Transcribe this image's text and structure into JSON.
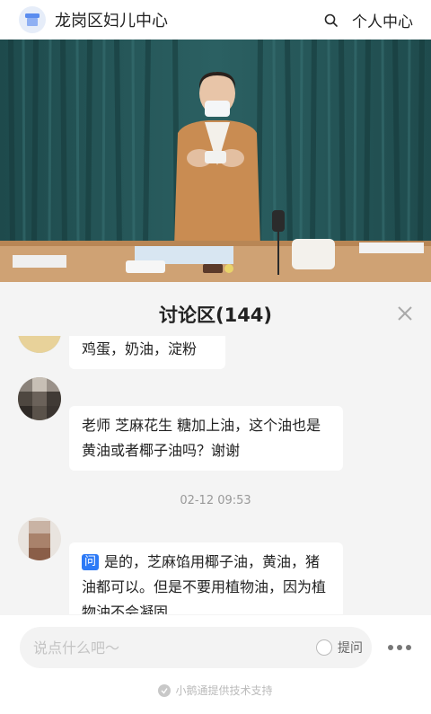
{
  "header": {
    "title": "龙岗区妇儿中心",
    "personal_center": "个人中心",
    "icons": {
      "store": "store-icon",
      "search": "search-icon"
    }
  },
  "video": {
    "content": "live-stream-video"
  },
  "discussion": {
    "title": "讨论区(144)",
    "close_icon": "close-icon",
    "messages": [
      {
        "text": "鸡蛋，奶油，淀粉"
      },
      {
        "text": "老师 芝麻花生 糖加上油，这个油也是黄油或者椰子油吗？谢谢"
      },
      {
        "time": "02-12 09:53"
      },
      {
        "tag": "问",
        "text": "是的，芝麻馅用椰子油，黄油，猪油都可以。但是不要用植物油，因为植物油不会凝固"
      }
    ]
  },
  "input": {
    "placeholder": "说点什么吧～",
    "ask_label": "提问",
    "more_icon": "more-icon"
  },
  "footer": {
    "text": "小鹅通提供技术支持"
  },
  "colors": {
    "accent": "#2d7af6",
    "panel_bg": "#f4f4f4"
  }
}
